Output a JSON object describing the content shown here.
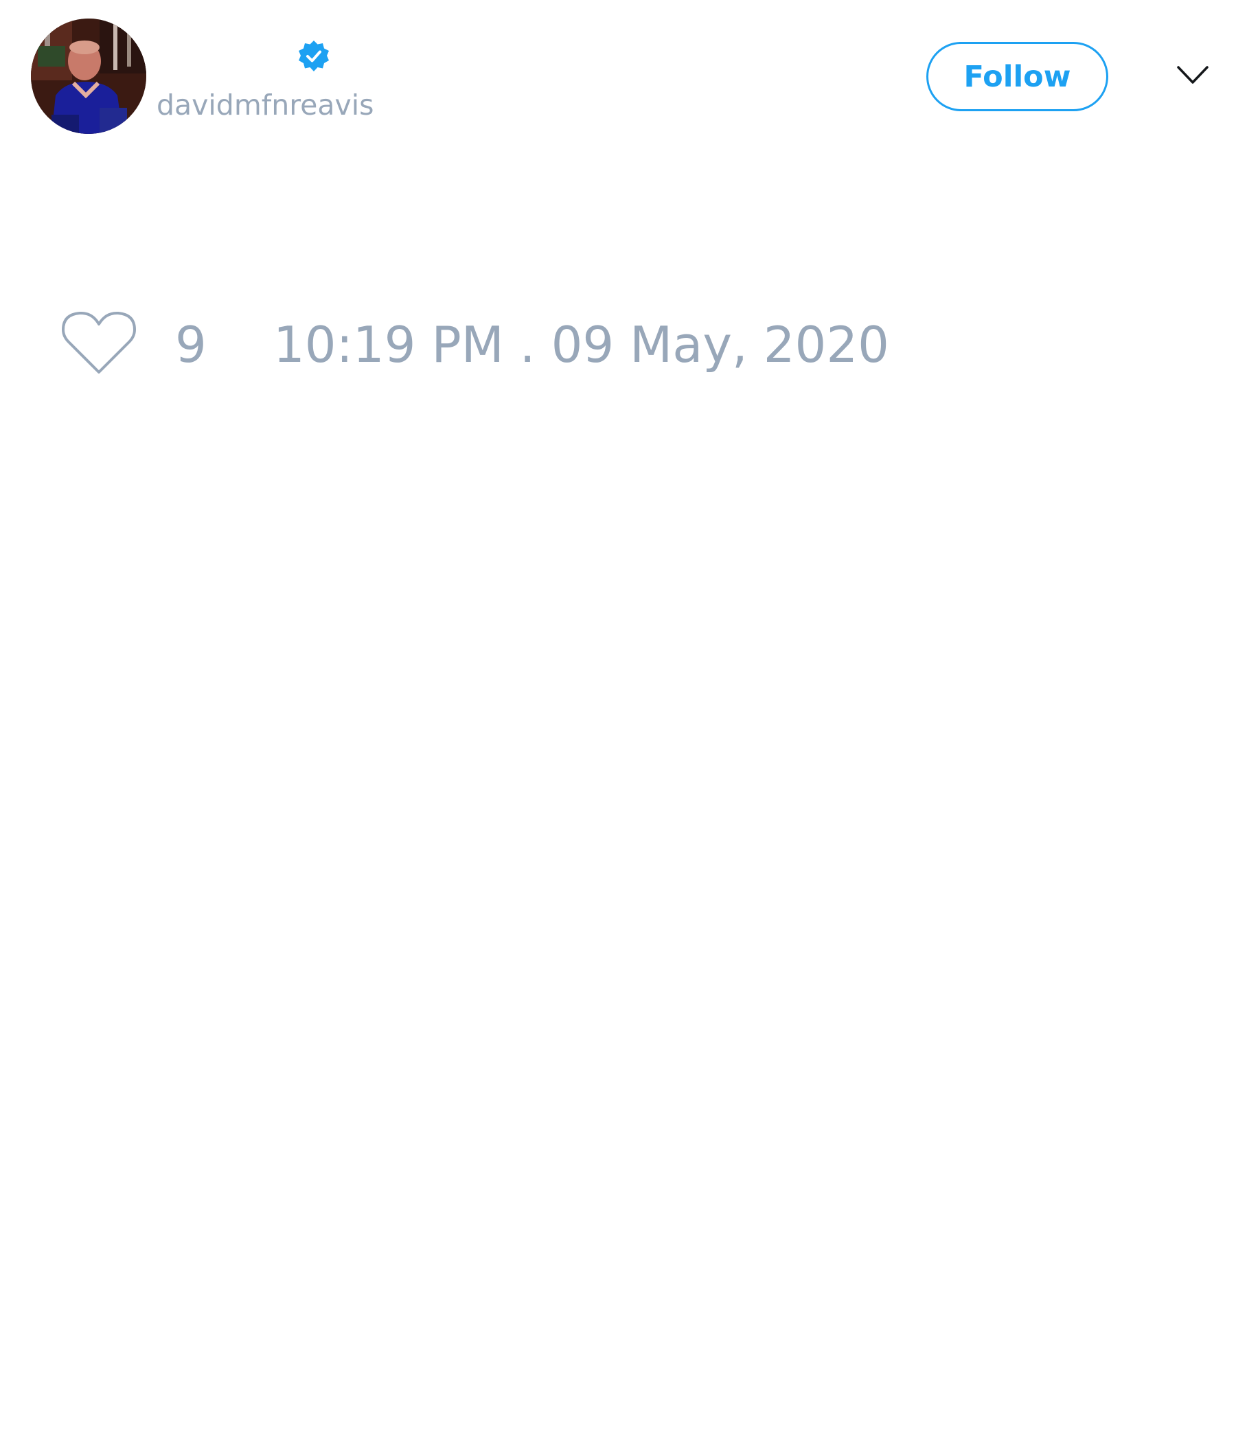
{
  "tweet": {
    "author": {
      "display_name": "",
      "handle": "davidmfnreavis",
      "verified": true,
      "avatar_icon": "avatar-photo"
    },
    "follow_label": "Follow",
    "menu_icon": "chevron-down-icon",
    "likes": {
      "icon": "heart-icon",
      "count": "9"
    },
    "timestamp": "10:19 PM . 09 May, 2020"
  },
  "colors": {
    "accent": "#1da1f2",
    "muted_text": "#98a7b9",
    "background": "#ffffff"
  }
}
